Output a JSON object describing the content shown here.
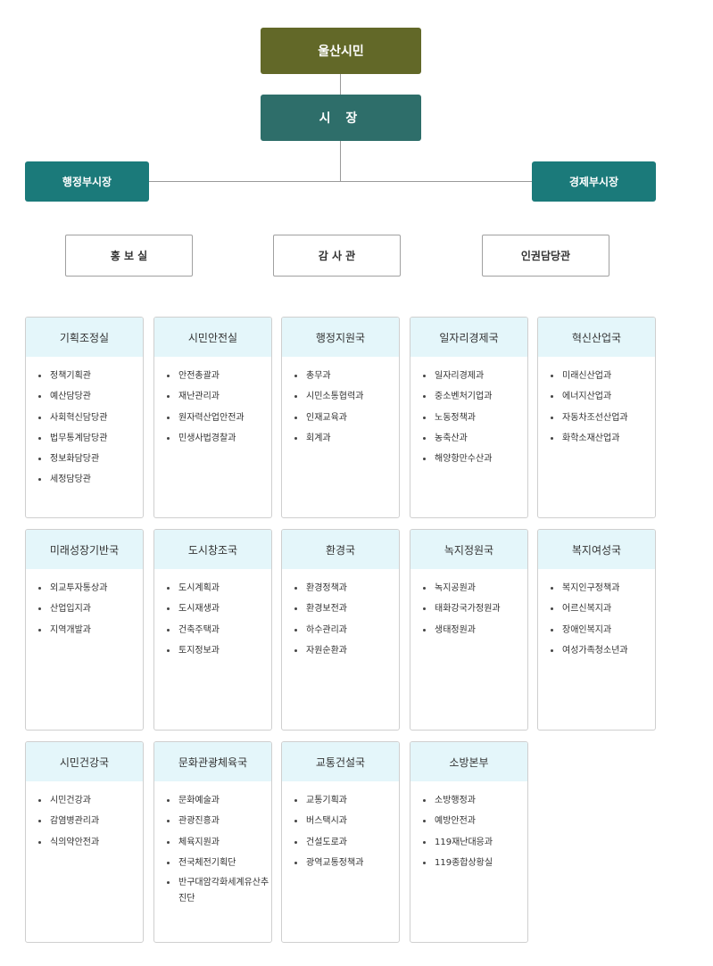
{
  "top": {
    "citizens": "울산시민",
    "mayor": "시 장",
    "vice_admin": "행정부시장",
    "vice_economy": "경제부시장"
  },
  "staff_offices": [
    "홍 보 실",
    "감 사 관",
    "인권담당관"
  ],
  "departments": [
    {
      "title": "기획조정실",
      "items": [
        "정책기획관",
        "예산담당관",
        "사회혁신담당관",
        "법무통계담당관",
        "정보화담당관",
        "세정담당관"
      ]
    },
    {
      "title": "시민안전실",
      "items": [
        "안전총괄과",
        "재난관리과",
        "원자력산업안전과",
        "민생사법경찰과"
      ]
    },
    {
      "title": "행정지원국",
      "items": [
        "총무과",
        "시민소통협력과",
        "인재교육과",
        "회계과"
      ]
    },
    {
      "title": "일자리경제국",
      "items": [
        "일자리경제과",
        "중소벤처기업과",
        "노동정책과",
        "농축산과",
        "해양항만수산과"
      ]
    },
    {
      "title": "혁신산업국",
      "items": [
        "미래신산업과",
        "에너지산업과",
        "자동차조선산업과",
        "화학소재산업과"
      ]
    },
    {
      "title": "미래성장기반국",
      "items": [
        "외교투자통상과",
        "산업입지과",
        "지역개발과"
      ]
    },
    {
      "title": "도시창조국",
      "items": [
        "도시계획과",
        "도시재생과",
        "건축주택과",
        "토지정보과"
      ]
    },
    {
      "title": "환경국",
      "items": [
        "환경정책과",
        "환경보전과",
        "하수관리과",
        "자원순환과"
      ]
    },
    {
      "title": "녹지정원국",
      "items": [
        "녹지공원과",
        "태화강국가정원과",
        "생태정원과"
      ]
    },
    {
      "title": "복지여성국",
      "items": [
        "복지인구정책과",
        "어르신복지과",
        "장애인복지과",
        "여성가족청소년과"
      ]
    },
    {
      "title": "시민건강국",
      "items": [
        "시민건강과",
        "감염병관리과",
        "식의약안전과"
      ]
    },
    {
      "title": "문화관광체육국",
      "items": [
        "문화예술과",
        "관광진흥과",
        "체육지원과",
        "전국체전기획단",
        "반구대암각화세계유산추진단"
      ]
    },
    {
      "title": "교통건설국",
      "items": [
        "교통기획과",
        "버스택시과",
        "건설도로과",
        "광역교통정책과"
      ]
    },
    {
      "title": "소방본부",
      "items": [
        "소방행정과",
        "예방안전과",
        "119재난대응과",
        "119종합상황실"
      ]
    }
  ]
}
